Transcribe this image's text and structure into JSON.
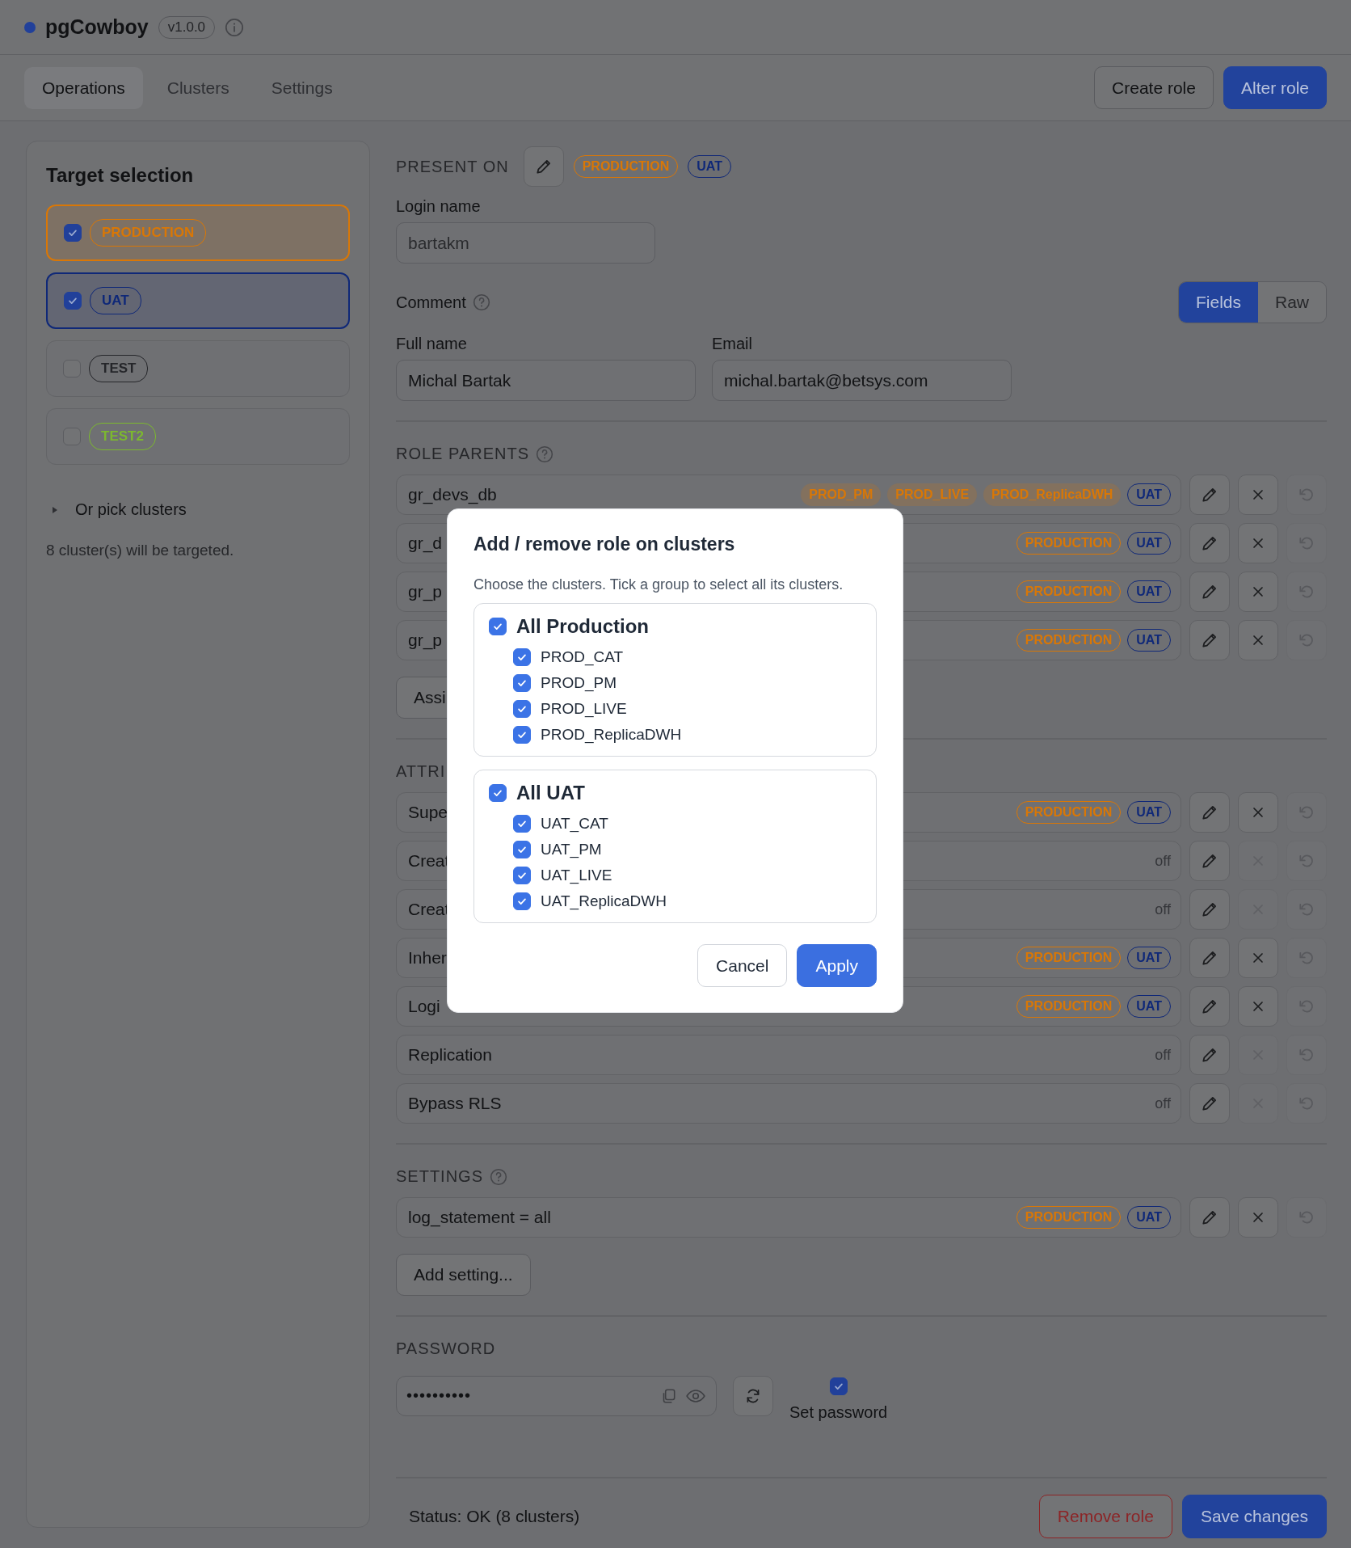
{
  "app": {
    "name": "pgCowboy",
    "version": "v1.0.0"
  },
  "tabs": [
    {
      "label": "Operations",
      "selected": true
    },
    {
      "label": "Clusters",
      "selected": false
    },
    {
      "label": "Settings",
      "selected": false
    }
  ],
  "header_buttons": [
    {
      "label": "Create role",
      "kind": "secondary"
    },
    {
      "label": "Alter role",
      "kind": "primary"
    }
  ],
  "sidebar": {
    "title": "Target selection",
    "groups": [
      {
        "label": "PRODUCTION",
        "checked": true,
        "color": "#d97706"
      },
      {
        "label": "UAT",
        "checked": true,
        "color": "#0f2878"
      },
      {
        "label": "TEST",
        "checked": false,
        "color": "#25262a"
      },
      {
        "label": "TEST2",
        "checked": false,
        "color": "#7cb82f"
      }
    ],
    "pick_clusters": {
      "label": "Or pick clusters",
      "expanded": false
    },
    "summary": "8 cluster(s) will be targeted."
  },
  "present_on": {
    "label": "PRESENT ON",
    "tags": [
      {
        "label": "PRODUCTION",
        "kind": "outline",
        "color": "#d97706"
      },
      {
        "label": "UAT",
        "kind": "outline",
        "color": "#0f2878"
      }
    ]
  },
  "login": {
    "label": "Login name",
    "value": "bartakm"
  },
  "comment": {
    "label": "Comment",
    "modes": [
      {
        "label": "Fields",
        "selected": true
      },
      {
        "label": "Raw",
        "selected": false
      }
    ]
  },
  "full_name": {
    "label": "Full name",
    "value": "Michal Bartak"
  },
  "email": {
    "label": "Email",
    "value": "michal.bartak@betsys.com"
  },
  "role_parents": {
    "heading": "ROLE PARENTS",
    "rows": [
      {
        "name": "gr_devs_db",
        "removable": true,
        "tags": [
          {
            "label": "PROD_PM",
            "kind": "soft",
            "color": "#d97706"
          },
          {
            "label": "PROD_LIVE",
            "kind": "soft",
            "color": "#d97706"
          },
          {
            "label": "PROD_ReplicaDWH",
            "kind": "soft",
            "color": "#d97706"
          },
          {
            "label": "UAT",
            "kind": "outline",
            "color": "#0f2878"
          }
        ]
      },
      {
        "name": "gr_d",
        "removable": true,
        "tags": [
          {
            "label": "PRODUCTION",
            "kind": "outline",
            "color": "#d97706"
          },
          {
            "label": "UAT",
            "kind": "outline",
            "color": "#0f2878"
          }
        ]
      },
      {
        "name": "gr_p",
        "removable": true,
        "tags": [
          {
            "label": "PRODUCTION",
            "kind": "outline",
            "color": "#d97706"
          },
          {
            "label": "UAT",
            "kind": "outline",
            "color": "#0f2878"
          }
        ]
      },
      {
        "name": "gr_p",
        "removable": true,
        "tags": [
          {
            "label": "PRODUCTION",
            "kind": "outline",
            "color": "#d97706"
          },
          {
            "label": "UAT",
            "kind": "outline",
            "color": "#0f2878"
          }
        ]
      }
    ],
    "add_button": "Assi"
  },
  "attributes": {
    "heading": "ATTRI",
    "rows": [
      {
        "name": "Supe",
        "removable": true,
        "tags": [
          {
            "label": "PRODUCTION",
            "kind": "outline",
            "color": "#d97706"
          },
          {
            "label": "UAT",
            "kind": "outline",
            "color": "#0f2878"
          }
        ]
      },
      {
        "name": "Creat",
        "removable": false,
        "value": "off"
      },
      {
        "name": "Creat",
        "removable": false,
        "value": "off"
      },
      {
        "name": "Inher",
        "removable": true,
        "tags": [
          {
            "label": "PRODUCTION",
            "kind": "outline",
            "color": "#d97706"
          },
          {
            "label": "UAT",
            "kind": "outline",
            "color": "#0f2878"
          }
        ]
      },
      {
        "name": "Logi",
        "removable": true,
        "tags": [
          {
            "label": "PRODUCTION",
            "kind": "outline",
            "color": "#d97706"
          },
          {
            "label": "UAT",
            "kind": "outline",
            "color": "#0f2878"
          }
        ]
      },
      {
        "name": "Replication",
        "removable": false,
        "value": "off"
      },
      {
        "name": "Bypass RLS",
        "removable": false,
        "value": "off"
      }
    ]
  },
  "settings": {
    "heading": "SETTINGS",
    "rows": [
      {
        "name": "log_statement = all",
        "removable": true,
        "tags": [
          {
            "label": "PRODUCTION",
            "kind": "outline",
            "color": "#d97706"
          },
          {
            "label": "UAT",
            "kind": "outline",
            "color": "#0f2878"
          }
        ]
      }
    ],
    "add_button": "Add setting..."
  },
  "password": {
    "heading": "PASSWORD",
    "value": "••••••••••",
    "set_password": {
      "label": "Set password",
      "checked": true
    }
  },
  "status": "Status: OK (8 clusters)",
  "footer_buttons": [
    {
      "label": "Remove role",
      "kind": "danger"
    },
    {
      "label": "Save changes",
      "kind": "primary"
    }
  ],
  "modal": {
    "title": "Add / remove role on clusters",
    "description": "Choose the clusters. Tick a group to select all its clusters.",
    "groups": [
      {
        "label": "All Production",
        "checked": true,
        "clusters": [
          {
            "label": "PROD_CAT",
            "checked": true
          },
          {
            "label": "PROD_PM",
            "checked": true
          },
          {
            "label": "PROD_LIVE",
            "checked": true
          },
          {
            "label": "PROD_ReplicaDWH",
            "checked": true
          }
        ]
      },
      {
        "label": "All UAT",
        "checked": true,
        "clusters": [
          {
            "label": "UAT_CAT",
            "checked": true
          },
          {
            "label": "UAT_PM",
            "checked": true
          },
          {
            "label": "UAT_LIVE",
            "checked": true
          },
          {
            "label": "UAT_ReplicaDWH",
            "checked": true
          }
        ]
      }
    ],
    "buttons": [
      {
        "label": "Cancel",
        "kind": "secondary"
      },
      {
        "label": "Apply",
        "kind": "primary"
      }
    ]
  }
}
